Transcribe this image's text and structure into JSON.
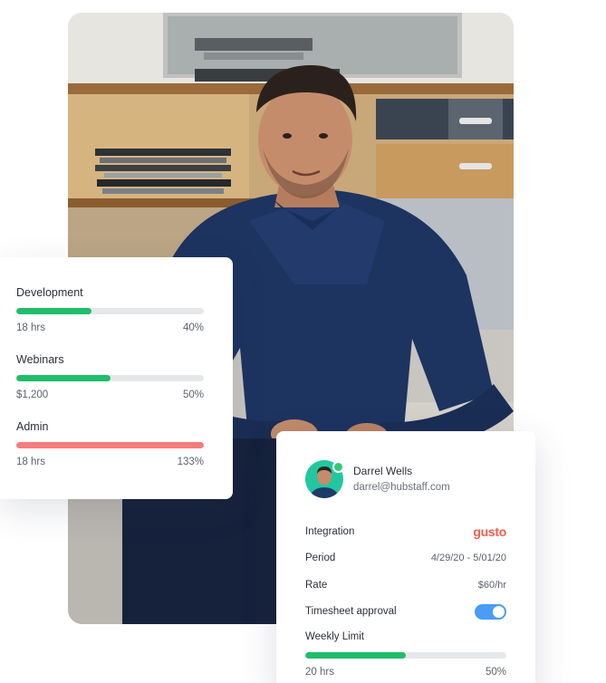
{
  "budgets": [
    {
      "name": "Development",
      "amount": "18 hrs",
      "percent_label": "40%",
      "fill": 0.4,
      "color": "#1fbe6a"
    },
    {
      "name": "Webinars",
      "amount": "$1,200",
      "percent_label": "50%",
      "fill": 0.5,
      "color": "#1fbe6a"
    },
    {
      "name": "Admin",
      "amount": "18 hrs",
      "percent_label": "133%",
      "fill": 1.0,
      "color": "#f77b7b"
    }
  ],
  "payroll": {
    "user": {
      "name": "Darrel Wells",
      "email": "darrel@hubstaff.com"
    },
    "rows": {
      "integration_label": "Integration",
      "integration_value": "gusto",
      "period_label": "Period",
      "period_value": "4/29/20 - 5/01/20",
      "rate_label": "Rate",
      "rate_value": "$60/hr",
      "approval_label": "Timesheet approval"
    },
    "approval_enabled": true,
    "weekly": {
      "label": "Weekly Limit",
      "amount": "20 hrs",
      "percent_label": "50%",
      "fill": 0.5,
      "color": "#1fbe6a"
    }
  },
  "colors": {
    "toggle_on": "#4a9cf5",
    "gusto_brand": "#f45d48",
    "online_status": "#2ecc71"
  }
}
